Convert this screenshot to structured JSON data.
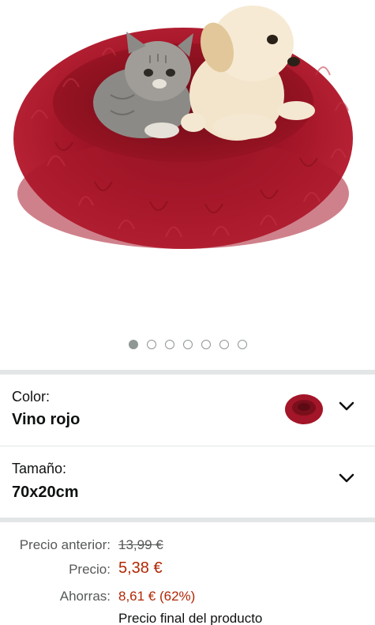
{
  "product": {
    "image_dots": {
      "count": 7,
      "active_index": 0
    }
  },
  "variants": {
    "color": {
      "label": "Color:",
      "value": "Vino rojo"
    },
    "size": {
      "label": "Tamaño:",
      "value": "70x20cm"
    }
  },
  "pricing": {
    "previous_label": "Precio anterior:",
    "previous_value": "13,99 €",
    "price_label": "Precio:",
    "price_value": "5,38 €",
    "savings_label": "Ahorras:",
    "savings_value": "8,61 € (62%)",
    "final_note": "Precio final del producto"
  },
  "colors": {
    "bed_red": "#a31528",
    "price_red": "#b12704",
    "muted_text": "#565959",
    "separator": "#e3e6e6"
  }
}
